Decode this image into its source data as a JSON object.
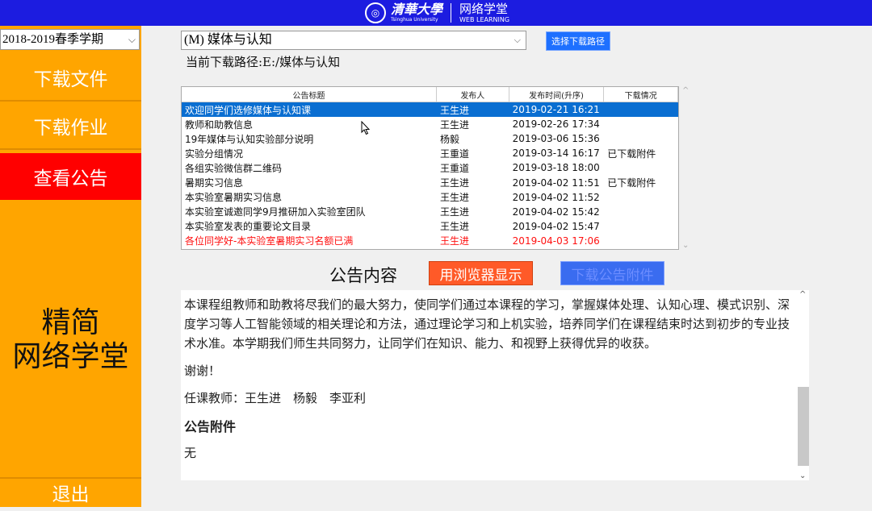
{
  "header": {
    "logo_cn": "清華大學",
    "logo_en": "Tsinghua University",
    "site_cn": "网络学堂",
    "site_en": "WEB LEARNING"
  },
  "sidebar": {
    "semester": "2018-2019春季学期",
    "items": [
      {
        "label": "下载文件",
        "active": false
      },
      {
        "label": "下载作业",
        "active": false
      },
      {
        "label": "查看公告",
        "active": true
      }
    ],
    "brand_line1": "精简",
    "brand_line2": "网络学堂",
    "exit": "退出"
  },
  "main": {
    "course": "(M) 媒体与认知",
    "select_path_button": "选择下载路径",
    "current_path": "当前下载路径:E:/媒体与认知",
    "table": {
      "columns": [
        "公告标题",
        "发布人",
        "发布时间(升序)",
        "下载情况"
      ],
      "rows": [
        [
          "欢迎同学们选修媒体与认知课",
          "王生进",
          "2019-02-21 16:21",
          ""
        ],
        [
          "教师和助教信息",
          "王生进",
          "2019-02-26 17:34",
          ""
        ],
        [
          "19年媒体与认知实验部分说明",
          "杨毅",
          "2019-03-06 15:36",
          ""
        ],
        [
          "实验分组情况",
          "王重道",
          "2019-03-14 16:17",
          "已下载附件"
        ],
        [
          "各组实验微信群二维码",
          "王重道",
          "2019-03-18 18:00",
          ""
        ],
        [
          "暑期实习信息",
          "王生进",
          "2019-04-02 11:51",
          "已下载附件"
        ],
        [
          "本实验室暑期实习信息",
          "王生进",
          "2019-04-02 11:52",
          ""
        ],
        [
          "本实验室诚邀同学9月推研加入实验室团队",
          "王生进",
          "2019-04-02 15:42",
          ""
        ],
        [
          "本实验室发表的重要论文目录",
          "王生进",
          "2019-04-02 15:47",
          ""
        ],
        [
          "各位同学好-本实验室暑期实习名额已满",
          "王生进",
          "2019-04-03 17:06",
          ""
        ]
      ],
      "selected_row": 0,
      "highlight_row": 9,
      "highlight_color": "#ff1010"
    },
    "content_title": "公告内容",
    "browser_button": "用浏览器显示",
    "attach_button": "下载公告附件",
    "content": {
      "paragraph1": "本课程组教师和助教将尽我们的最大努力，使同学们通过本课程的学习，掌握媒体处理、认知心理、模式识别、深度学习等人工智能领域的相关理论和方法，通过理论学习和上机实验，培养同学们在课程结束时达到初步的专业技术水准。本学期我们师生共同努力，让同学们在知识、能力、和视野上获得优异的收获。",
      "paragraph2": "谢谢！",
      "paragraph3": "任课教师：王生进　杨毅　李亚利",
      "attachments_heading": "公告附件",
      "attachments_value": "无"
    }
  },
  "colors": {
    "topbar": "#1c1ce0",
    "sidebar": "#ffa500",
    "active_nav": "#ff0000",
    "selection": "#0a6ed1"
  }
}
